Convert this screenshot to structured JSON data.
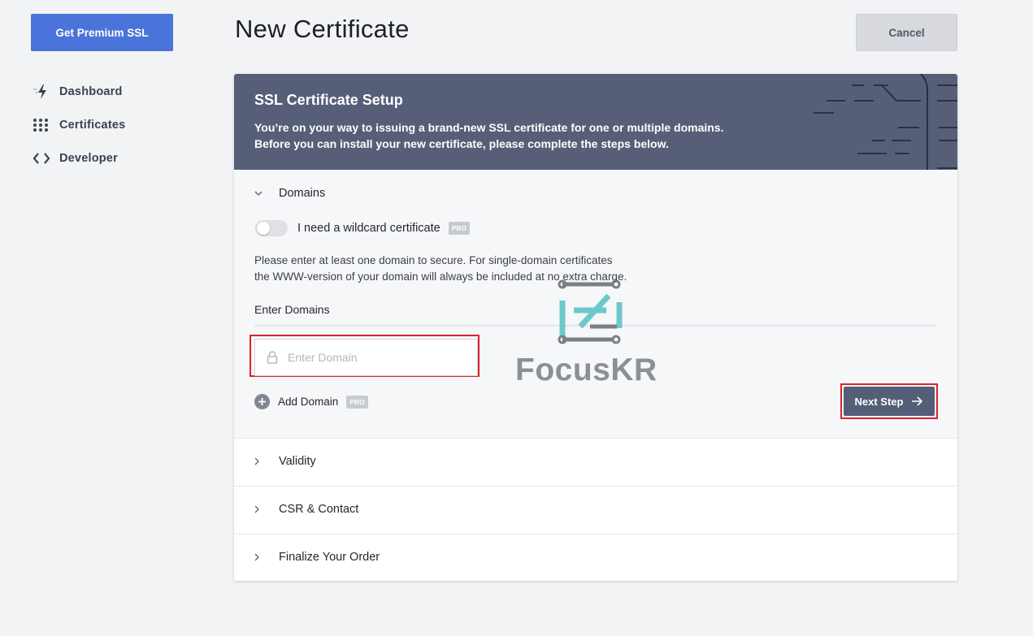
{
  "sidebar": {
    "premium_button": "Get Premium SSL",
    "items": [
      {
        "label": "Dashboard",
        "icon": "bolt-icon"
      },
      {
        "label": "Certificates",
        "icon": "grid-dots-icon"
      },
      {
        "label": "Developer",
        "icon": "code-brackets-icon"
      }
    ]
  },
  "header": {
    "title": "New Certificate",
    "cancel_label": "Cancel"
  },
  "banner": {
    "title": "SSL Certificate Setup",
    "line1": "You’re on your way to issuing a brand-new SSL certificate for one or multiple domains.",
    "line2": "Before you can install your new certificate, please complete the steps below."
  },
  "domains": {
    "section_label": "Domains",
    "wildcard_label": "I need a wildcard certificate",
    "wildcard_enabled": false,
    "pro_badge": "PRO",
    "info_line1": "Please enter at least one domain to secure. For single-domain certificates",
    "info_line2": "the WWW-version of your domain will always be included at no extra charge.",
    "enter_domains_label": "Enter Domains",
    "input_placeholder": "Enter Domain",
    "input_value": "",
    "add_domain_label": "Add Domain",
    "next_step_label": "Next Step"
  },
  "sections": [
    {
      "label": "Validity"
    },
    {
      "label": "CSR & Contact"
    },
    {
      "label": "Finalize Your Order"
    }
  ],
  "watermark": "FocusKR",
  "colors": {
    "accent_blue": "#4a74d9",
    "banner": "#575f78",
    "highlight_red": "#d9232d",
    "next_button": "#555e77"
  }
}
